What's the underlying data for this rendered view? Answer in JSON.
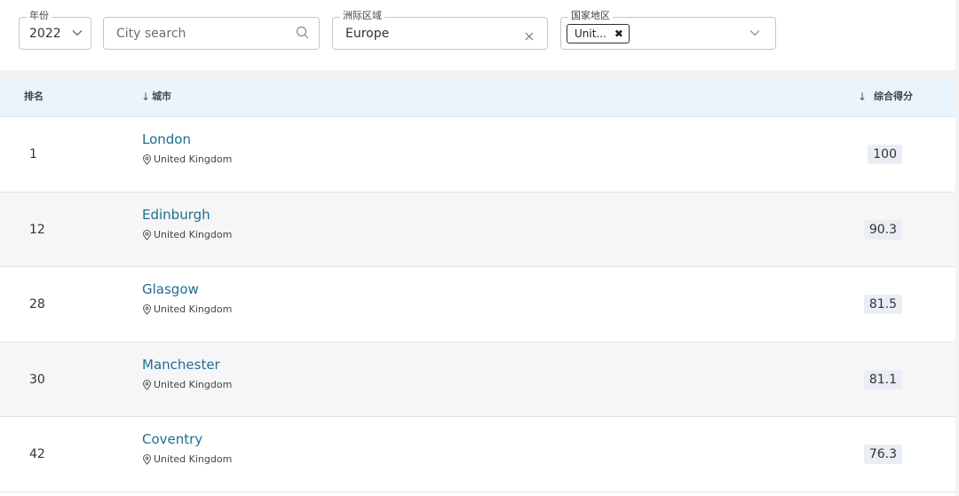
{
  "filters": {
    "year": {
      "label": "年份",
      "value": "2022"
    },
    "search": {
      "placeholder": "City search"
    },
    "region": {
      "label": "洲际区域",
      "value": "Europe"
    },
    "country": {
      "label": "国家地区",
      "chip": "Unit...",
      "chip_remove": "✖"
    }
  },
  "table": {
    "headers": {
      "rank": "排名",
      "city": "城市",
      "score": "综合得分",
      "sort_arrow": "↓"
    },
    "rows": [
      {
        "rank": "1",
        "city": "London",
        "country": "United Kingdom",
        "score": "100"
      },
      {
        "rank": "12",
        "city": "Edinburgh",
        "country": "United Kingdom",
        "score": "90.3"
      },
      {
        "rank": "28",
        "city": "Glasgow",
        "country": "United Kingdom",
        "score": "81.5"
      },
      {
        "rank": "30",
        "city": "Manchester",
        "country": "United Kingdom",
        "score": "81.1"
      },
      {
        "rank": "42",
        "city": "Coventry",
        "country": "United Kingdom",
        "score": "76.3"
      }
    ]
  },
  "icons": {
    "dropdown": "chevron-down-icon",
    "search": "search-icon",
    "clear": "close-icon",
    "location": "location-pin-icon"
  }
}
